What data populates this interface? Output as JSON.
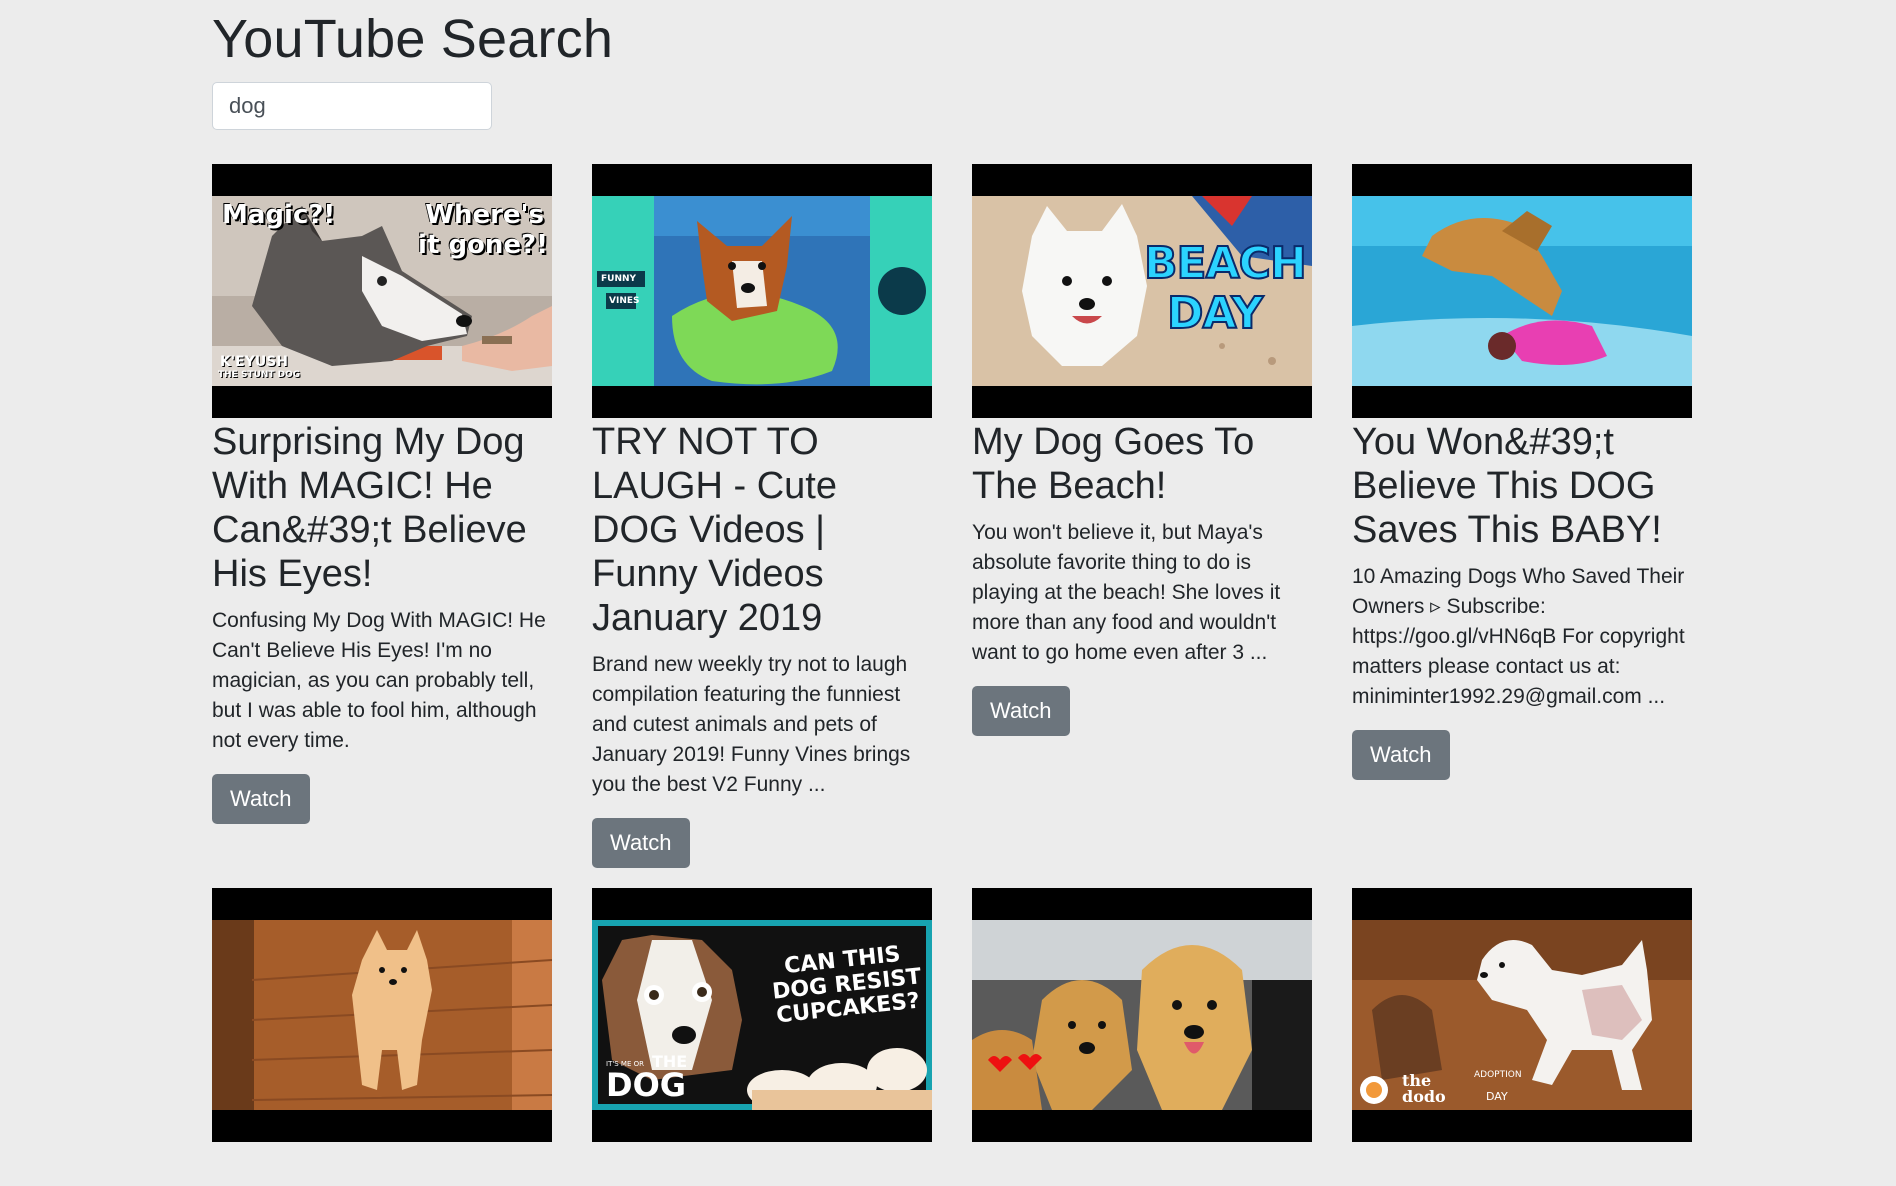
{
  "header": {
    "title": "YouTube Search"
  },
  "search": {
    "value": "dog",
    "placeholder": ""
  },
  "watch_label": "Watch",
  "videos": [
    {
      "title": "Surprising My Dog With MAGIC! He Can&#39;t Believe His Eyes!",
      "description": "Confusing My Dog With MAGIC! He Can't Believe His Eyes! I'm no magician, as you can probably tell, but I was able to fool him, although not every time.",
      "thumbnail_text": [
        "Magic?!",
        "Where's",
        "it gone?!",
        "K'EYUSH",
        "THE STUNT DOG"
      ]
    },
    {
      "title": "TRY NOT TO LAUGH - Cute DOG Videos | Funny Videos January 2019",
      "description": "Brand new weekly try not to laugh compilation featuring the funniest and cutest animals and pets of January 2019! Funny Vines brings you the best V2 Funny ...",
      "thumbnail_text": [
        "FUNNY",
        "VINES"
      ]
    },
    {
      "title": "My Dog Goes To The Beach!",
      "description": "You won't believe it, but Maya's absolute favorite thing to do is playing at the beach! She loves it more than any food and wouldn't want to go home even after 3 ...",
      "thumbnail_text": [
        "BEACH",
        "DAY"
      ]
    },
    {
      "title": "You Won&#39;t Believe This DOG Saves This BABY!",
      "description": "10 Amazing Dogs Who Saved Their Owners ▹ Subscribe: https://goo.gl/vHN6qB For copyright matters please contact us at: miniminter1992.29@gmail.com ...",
      "thumbnail_text": []
    },
    {
      "title": "",
      "description": "",
      "thumbnail_text": []
    },
    {
      "title": "",
      "description": "",
      "thumbnail_text": [
        "CAN THIS",
        "DOG RESIST",
        "CUPCAKES?",
        "IT'S ME OR",
        "THE",
        "DOG"
      ]
    },
    {
      "title": "",
      "description": "",
      "thumbnail_text": []
    },
    {
      "title": "",
      "description": "",
      "thumbnail_text": [
        "the",
        "dodo",
        "ADOPTION",
        "DAY"
      ]
    }
  ],
  "colors": {
    "background": "#ececec",
    "button": "#6c757d",
    "thumbnail_frame": "#000000"
  }
}
